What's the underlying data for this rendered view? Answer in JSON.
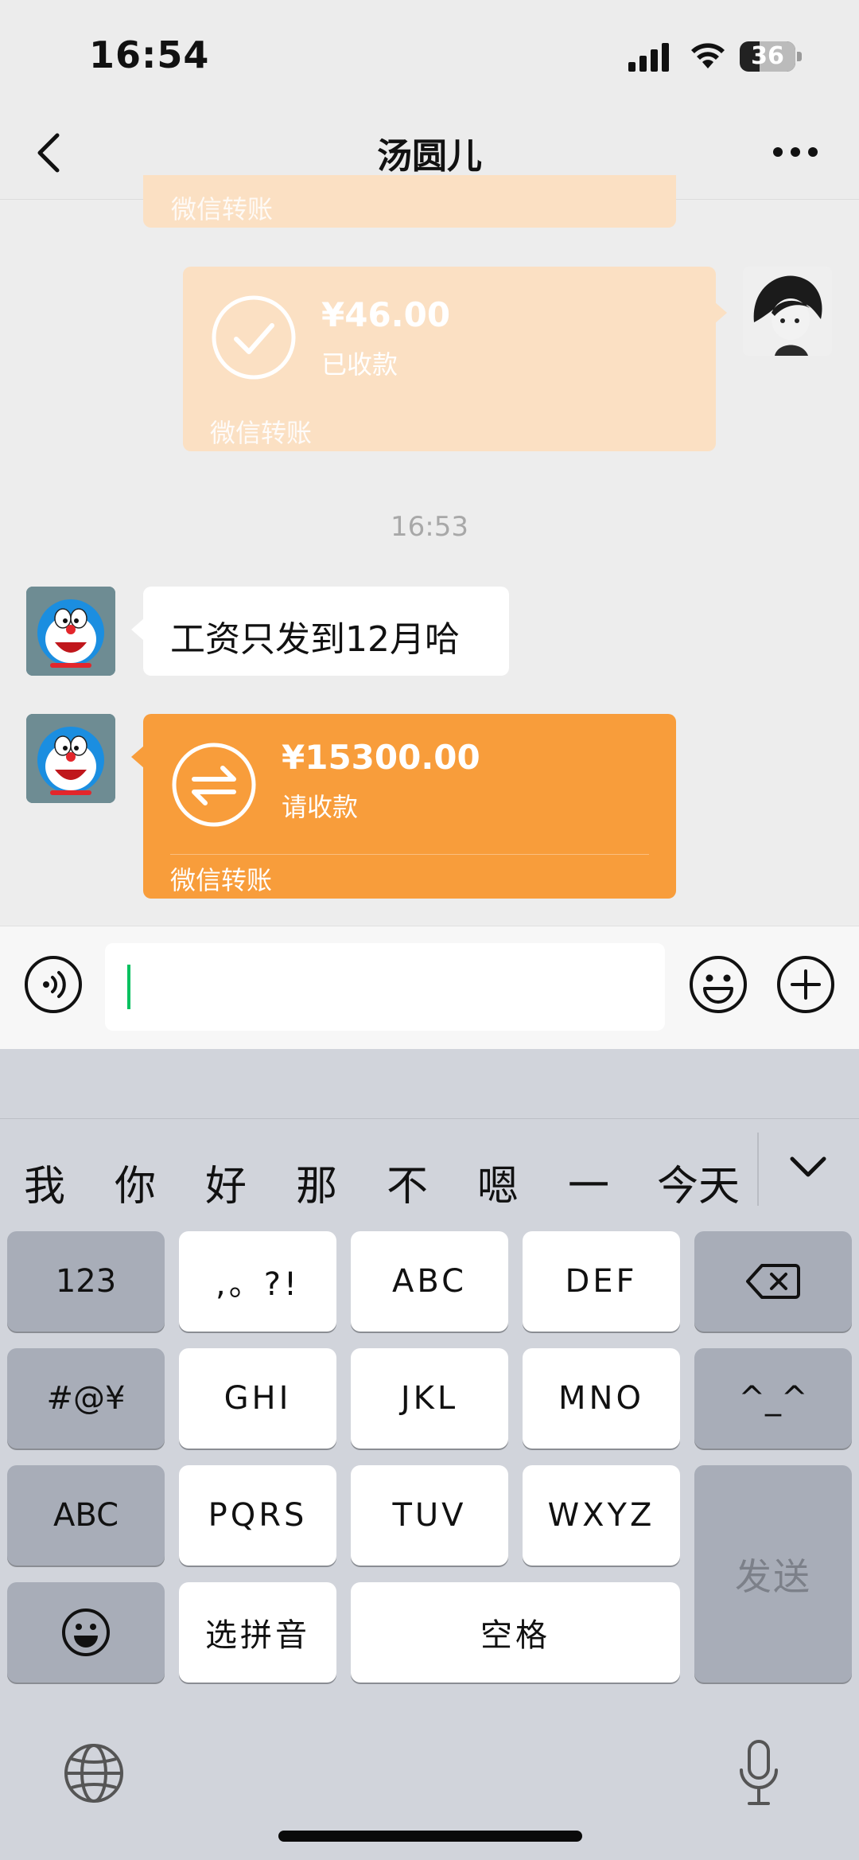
{
  "status_bar": {
    "time": "16:54",
    "battery": "36",
    "battery_level_pct": 36
  },
  "nav": {
    "title": "汤圆儿",
    "back_icon": "chevron-left-icon",
    "more_icon": "more-dots-icon"
  },
  "messages": [
    {
      "type": "transfer-partial",
      "label": "微信转账"
    },
    {
      "type": "transfer",
      "sender": "me",
      "amount": "¥46.00",
      "status": "已收款",
      "label": "微信转账",
      "icon": "check-circle-icon",
      "color": "#fbe0c3"
    },
    {
      "type": "timestamp",
      "text": "16:53"
    },
    {
      "type": "text",
      "sender": "peer",
      "text": "工资只发到12月哈"
    },
    {
      "type": "transfer",
      "sender": "peer",
      "amount": "¥15300.00",
      "status": "请收款",
      "label": "微信转账",
      "icon": "transfer-arrows-icon",
      "color": "#f89d3b"
    }
  ],
  "input_bar": {
    "value": "",
    "voice_icon": "voice-icon",
    "emoji_icon": "emoji-icon",
    "plus_icon": "plus-circle-icon"
  },
  "keyboard": {
    "candidates": [
      "我",
      "你",
      "好",
      "那",
      "不",
      "嗯",
      "一",
      "今天"
    ],
    "rows": [
      [
        "123",
        ",。?!",
        "ABC",
        "DEF",
        "⌫"
      ],
      [
        "#@¥",
        "GHI",
        "JKL",
        "MNO",
        "^_^"
      ],
      [
        "ABC",
        "PQRS",
        "TUV",
        "WXYZ"
      ],
      [
        "☺",
        "选拼音",
        "空格"
      ]
    ],
    "send": "发送"
  },
  "colors": {
    "accent_green": "#07c160",
    "transfer_orange": "#f89d3b",
    "transfer_received": "#fbe0c3"
  }
}
